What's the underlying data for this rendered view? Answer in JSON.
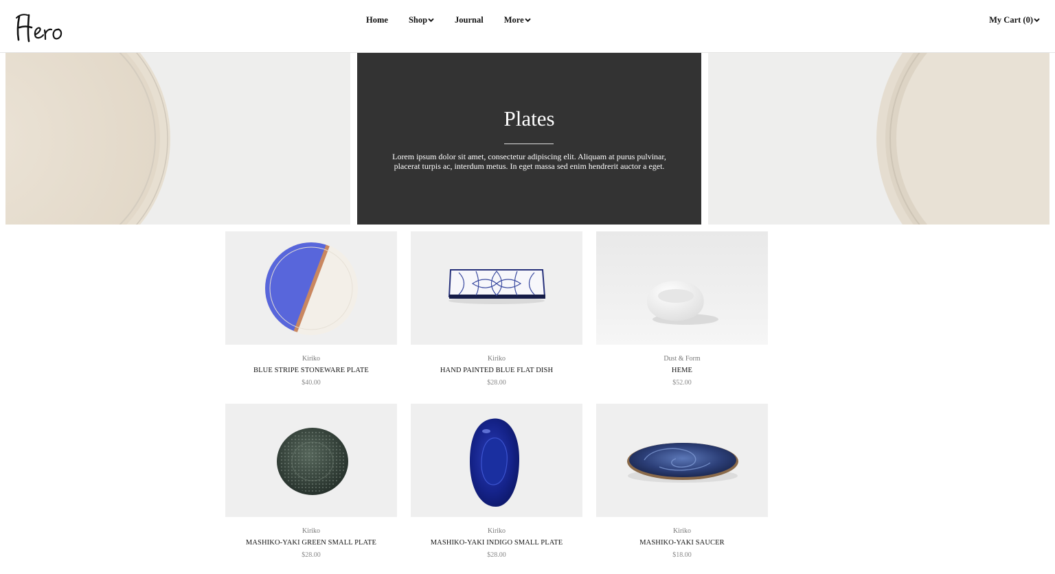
{
  "brand": {
    "logo_text": "Hero"
  },
  "nav": {
    "items": [
      {
        "label": "Home",
        "has_dropdown": false
      },
      {
        "label": "Shop",
        "has_dropdown": true
      },
      {
        "label": "Journal",
        "has_dropdown": false
      },
      {
        "label": "More",
        "has_dropdown": true
      }
    ],
    "cart_label": "My Cart (0)"
  },
  "hero": {
    "title": "Plates",
    "description": "Lorem ipsum dolor sit amet, consectetur adipiscing elit. Aliquam at purus pulvinar, placerat turpis ac, interdum metus. In eget massa sed enim hendrerit auctor a eget."
  },
  "products": [
    {
      "vendor": "Kiriko",
      "title": "BLUE STRIPE STONEWARE PLATE",
      "price": "$40.00"
    },
    {
      "vendor": "Kiriko",
      "title": "HAND PAINTED BLUE FLAT DISH",
      "price": "$28.00"
    },
    {
      "vendor": "Dust & Form",
      "title": "HEME",
      "price": "$52.00"
    },
    {
      "vendor": "Kiriko",
      "title": "MASHIKO-YAKI GREEN SMALL PLATE",
      "price": "$28.00"
    },
    {
      "vendor": "Kiriko",
      "title": "MASHIKO-YAKI INDIGO SMALL PLATE",
      "price": "$28.00"
    },
    {
      "vendor": "Kiriko",
      "title": "MASHIKO-YAKI SAUCER",
      "price": "$18.00"
    }
  ],
  "colors": {
    "hero_center_bg": "#333333",
    "page_bg": "#ffffff",
    "image_bg": "#efefef"
  }
}
